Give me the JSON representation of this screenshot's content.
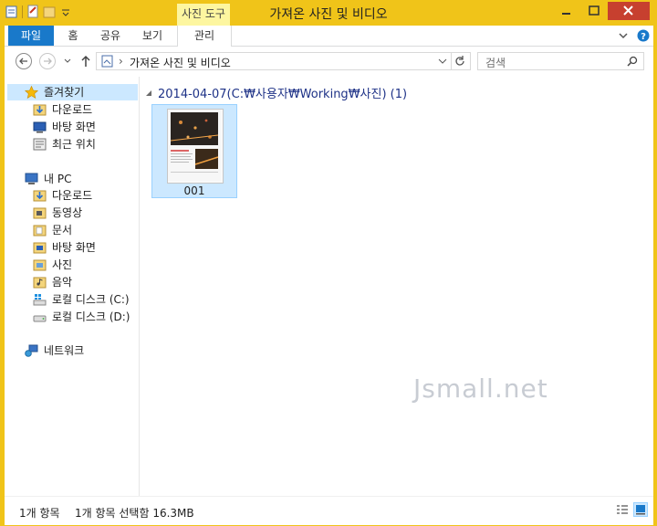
{
  "window": {
    "title": "가져온 사진 및 비디오",
    "context_tab_group": "사진 도구"
  },
  "ribbon": {
    "tabs": [
      "파일",
      "홈",
      "공유",
      "보기",
      "관리"
    ]
  },
  "address": {
    "path_segment": "가져온 사진 및 비디오",
    "separator": "›"
  },
  "search": {
    "placeholder": "검색"
  },
  "nav": {
    "favorites": {
      "label": "즐겨찾기",
      "items": [
        "다운로드",
        "바탕 화면",
        "최근 위치"
      ]
    },
    "pc": {
      "label": "내 PC",
      "items": [
        "다운로드",
        "동영상",
        "문서",
        "바탕 화면",
        "사진",
        "음악",
        "로컬 디스크 (C:)",
        "로컬 디스크 (D:)"
      ]
    },
    "network": {
      "label": "네트워크"
    }
  },
  "content": {
    "group_header": "2014-04-07(C:₩사용자₩Working₩사진) (1)",
    "files": [
      {
        "name": "001"
      }
    ],
    "watermark": "Jsmall.net"
  },
  "status": {
    "item_count": "1개 항목",
    "selection": "1개 항목 선택함 16.3MB"
  },
  "colors": {
    "frame": "#f0c419",
    "file_tab": "#1979ca",
    "selection": "#cce8ff",
    "context_tab": "#fdf6a0",
    "group_header": "#1e3287"
  }
}
